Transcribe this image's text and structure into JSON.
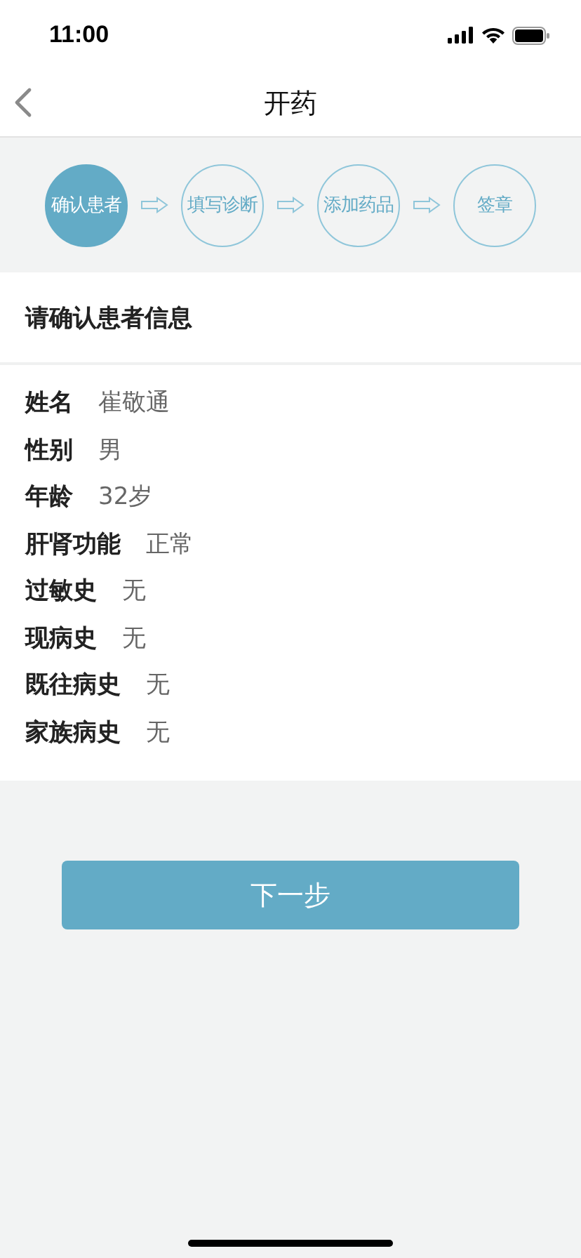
{
  "status_bar": {
    "time": "11:00"
  },
  "nav": {
    "title": "开药"
  },
  "steps": [
    {
      "label": "确认患者",
      "selected": true
    },
    {
      "label": "填写诊断",
      "selected": false
    },
    {
      "label": "添加药品",
      "selected": false
    },
    {
      "label": "签章",
      "selected": false
    }
  ],
  "section_title": "请确认患者信息",
  "fields": [
    {
      "label": "姓名",
      "value": "崔敬通"
    },
    {
      "label": "性别",
      "value": "男"
    },
    {
      "label": "年龄",
      "value": "32岁"
    },
    {
      "label": "肝肾功能",
      "value": "正常"
    },
    {
      "label": "过敏史",
      "value": "无"
    },
    {
      "label": "现病史",
      "value": "无"
    },
    {
      "label": "既往病史",
      "value": "无"
    },
    {
      "label": "家族病史",
      "value": "无"
    }
  ],
  "next_button": "下一步"
}
